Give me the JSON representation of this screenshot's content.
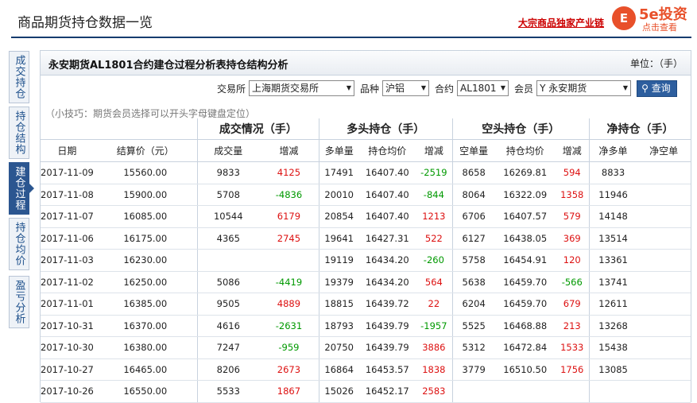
{
  "header": {
    "page_title": "商品期货持仓数据一览",
    "promo": "大宗商品独家产业链",
    "logo_circle": "E",
    "logo_brand": "5e投资",
    "logo_sub": "点击查看"
  },
  "sidetabs": [
    {
      "label": "成交持仓",
      "active": false
    },
    {
      "label": "持仓结构",
      "active": false
    },
    {
      "label": "建仓过程",
      "active": true
    },
    {
      "label": "持仓均价",
      "active": false
    },
    {
      "label": "盈亏分析",
      "active": false
    }
  ],
  "panel": {
    "title": "永安期货AL1801合约建仓过程分析表持仓结构分析",
    "unit": "单位：（手）"
  },
  "filters": {
    "exchange_label": "交易所",
    "exchange_value": "上海期货交易所",
    "variety_label": "品种",
    "variety_value": "沪铝",
    "contract_label": "合约",
    "contract_value": "AL1801",
    "member_label": "会员",
    "member_value": "Y 永安期货",
    "query_label": "查询"
  },
  "tip": "（小技巧：期货会员选择可以开头字母键盘定位）",
  "table": {
    "groups": [
      "成交情况（手）",
      "多头持仓（手）",
      "空头持仓（手）",
      "净持仓（手）"
    ],
    "columns": [
      "日期",
      "结算价（元）",
      "成交量",
      "增减",
      "多单量",
      "持仓均价",
      "增减",
      "空单量",
      "持仓均价",
      "增减",
      "净多单",
      "净空单"
    ],
    "rows": [
      [
        "2017-11-09",
        "15560.00",
        "9833",
        "4125",
        "17491",
        "16407.40",
        "-2519",
        "8658",
        "16269.81",
        "594",
        "8833",
        ""
      ],
      [
        "2017-11-08",
        "15900.00",
        "5708",
        "-4836",
        "20010",
        "16407.40",
        "-844",
        "8064",
        "16322.09",
        "1358",
        "11946",
        ""
      ],
      [
        "2017-11-07",
        "16085.00",
        "10544",
        "6179",
        "20854",
        "16407.40",
        "1213",
        "6706",
        "16407.57",
        "579",
        "14148",
        ""
      ],
      [
        "2017-11-06",
        "16175.00",
        "4365",
        "2745",
        "19641",
        "16427.31",
        "522",
        "6127",
        "16438.05",
        "369",
        "13514",
        ""
      ],
      [
        "2017-11-03",
        "16230.00",
        "",
        "",
        "19119",
        "16434.20",
        "-260",
        "5758",
        "16454.91",
        "120",
        "13361",
        ""
      ],
      [
        "2017-11-02",
        "16250.00",
        "5086",
        "-4419",
        "19379",
        "16434.20",
        "564",
        "5638",
        "16459.70",
        "-566",
        "13741",
        ""
      ],
      [
        "2017-11-01",
        "16385.00",
        "9505",
        "4889",
        "18815",
        "16439.72",
        "22",
        "6204",
        "16459.70",
        "679",
        "12611",
        ""
      ],
      [
        "2017-10-31",
        "16370.00",
        "4616",
        "-2631",
        "18793",
        "16439.79",
        "-1957",
        "5525",
        "16468.88",
        "213",
        "13268",
        ""
      ],
      [
        "2017-10-30",
        "16380.00",
        "7247",
        "-959",
        "20750",
        "16439.79",
        "3886",
        "5312",
        "16472.84",
        "1533",
        "15438",
        ""
      ],
      [
        "2017-10-27",
        "16465.00",
        "8206",
        "2673",
        "16864",
        "16453.57",
        "1838",
        "3779",
        "16510.50",
        "1756",
        "13085",
        ""
      ],
      [
        "2017-10-26",
        "16550.00",
        "5533",
        "1867",
        "15026",
        "16452.17",
        "2583",
        "",
        "",
        "",
        "",
        ""
      ]
    ]
  },
  "colors": {
    "positive": "#dd1111",
    "negative": "#009900",
    "accent": "#2b5690"
  }
}
